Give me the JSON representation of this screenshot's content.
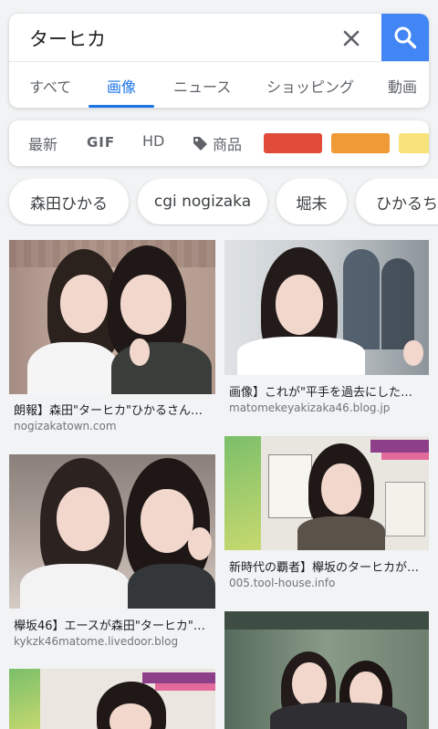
{
  "search": {
    "query": "ターヒカ",
    "clear_icon": "close-icon",
    "search_icon": "search-icon",
    "accent_color": "#4285f4"
  },
  "tabs": [
    {
      "label": "すべて",
      "active": false
    },
    {
      "label": "画像",
      "active": true
    },
    {
      "label": "ニュース",
      "active": false
    },
    {
      "label": "ショッピング",
      "active": false
    },
    {
      "label": "動画",
      "active": false
    }
  ],
  "filters": {
    "latest": "最新",
    "gif": "GIF",
    "hd": "HD",
    "products": "商品",
    "product_icon": "tag-icon",
    "colors": [
      "#e04b3a",
      "#f09a36",
      "#f8e27a"
    ]
  },
  "chips": [
    "森田ひかる",
    "cgi nogizaka",
    "堀未",
    "ひかるち"
  ],
  "results": [
    {
      "title": "朗報】森田\"ターヒカ\"ひかるさん…",
      "source": "nogizakatown.com"
    },
    {
      "title": "画像】これが\"平手を過去にした…",
      "source": "matomekeyakizaka46.blog.jp"
    },
    {
      "title": "欅坂46】エースが森田\"ターヒカ\"…",
      "source": "kykzk46matome.livedoor.blog"
    },
    {
      "title": "新時代の覇者】欅坂のターヒカが…",
      "source": "005.tool-house.info"
    },
    {
      "title": "",
      "source": ""
    },
    {
      "title": "",
      "source": ""
    }
  ]
}
